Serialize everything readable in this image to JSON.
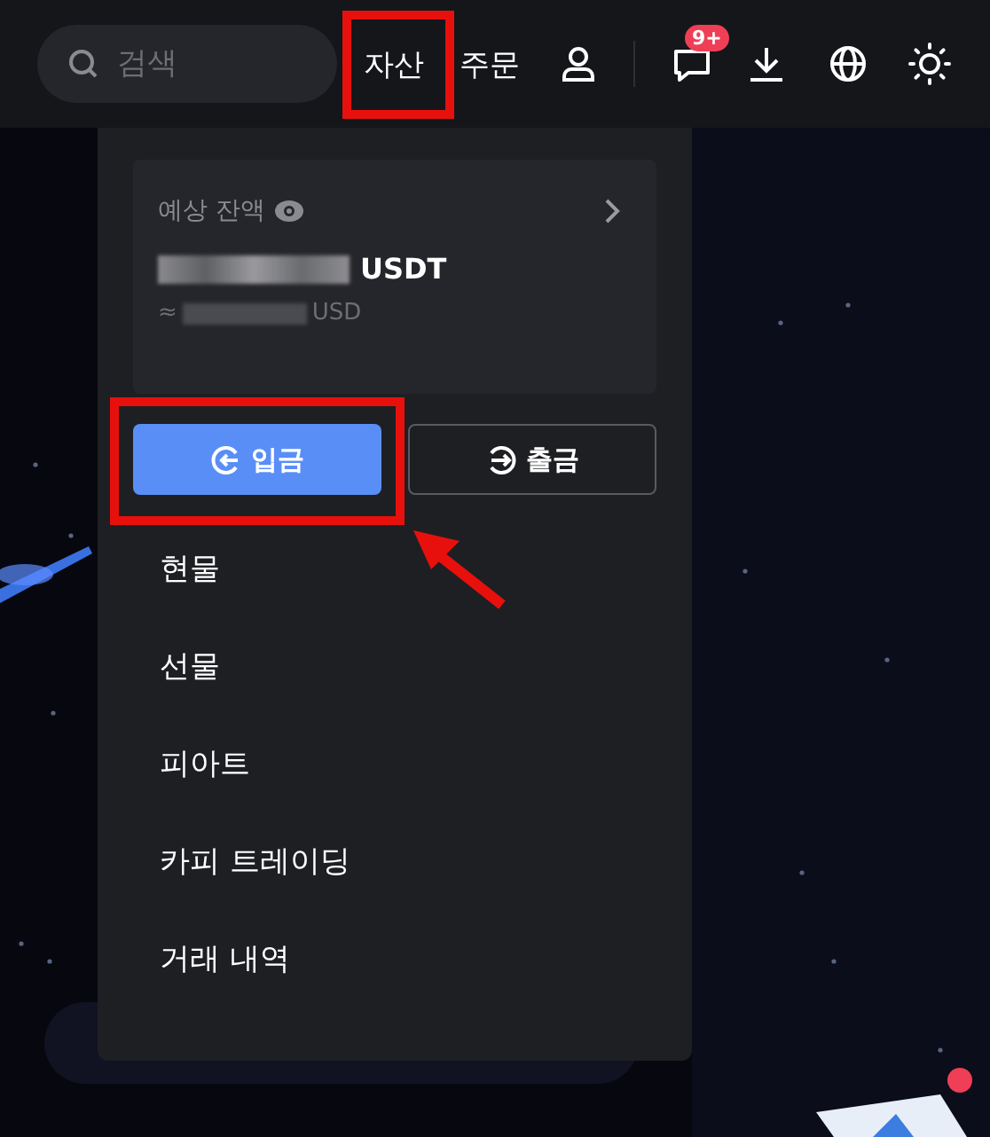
{
  "header": {
    "search": {
      "placeholder": "검색"
    },
    "nav": [
      {
        "label": "자산",
        "highlighted": true
      },
      {
        "label": "주문",
        "highlighted": false
      }
    ],
    "notification_badge": "9+"
  },
  "assets_menu": {
    "balance_label": "예상 잔액",
    "balance_currency": "USDT",
    "approx_symbol": "≈",
    "approx_currency": "USD",
    "buttons": [
      {
        "label": "입금",
        "kind": "deposit",
        "highlighted": true
      },
      {
        "label": "출금",
        "kind": "withdraw",
        "highlighted": false
      }
    ],
    "items": [
      "현물",
      "선물",
      "피아트",
      "카피 트레이딩",
      "거래 내역"
    ]
  }
}
